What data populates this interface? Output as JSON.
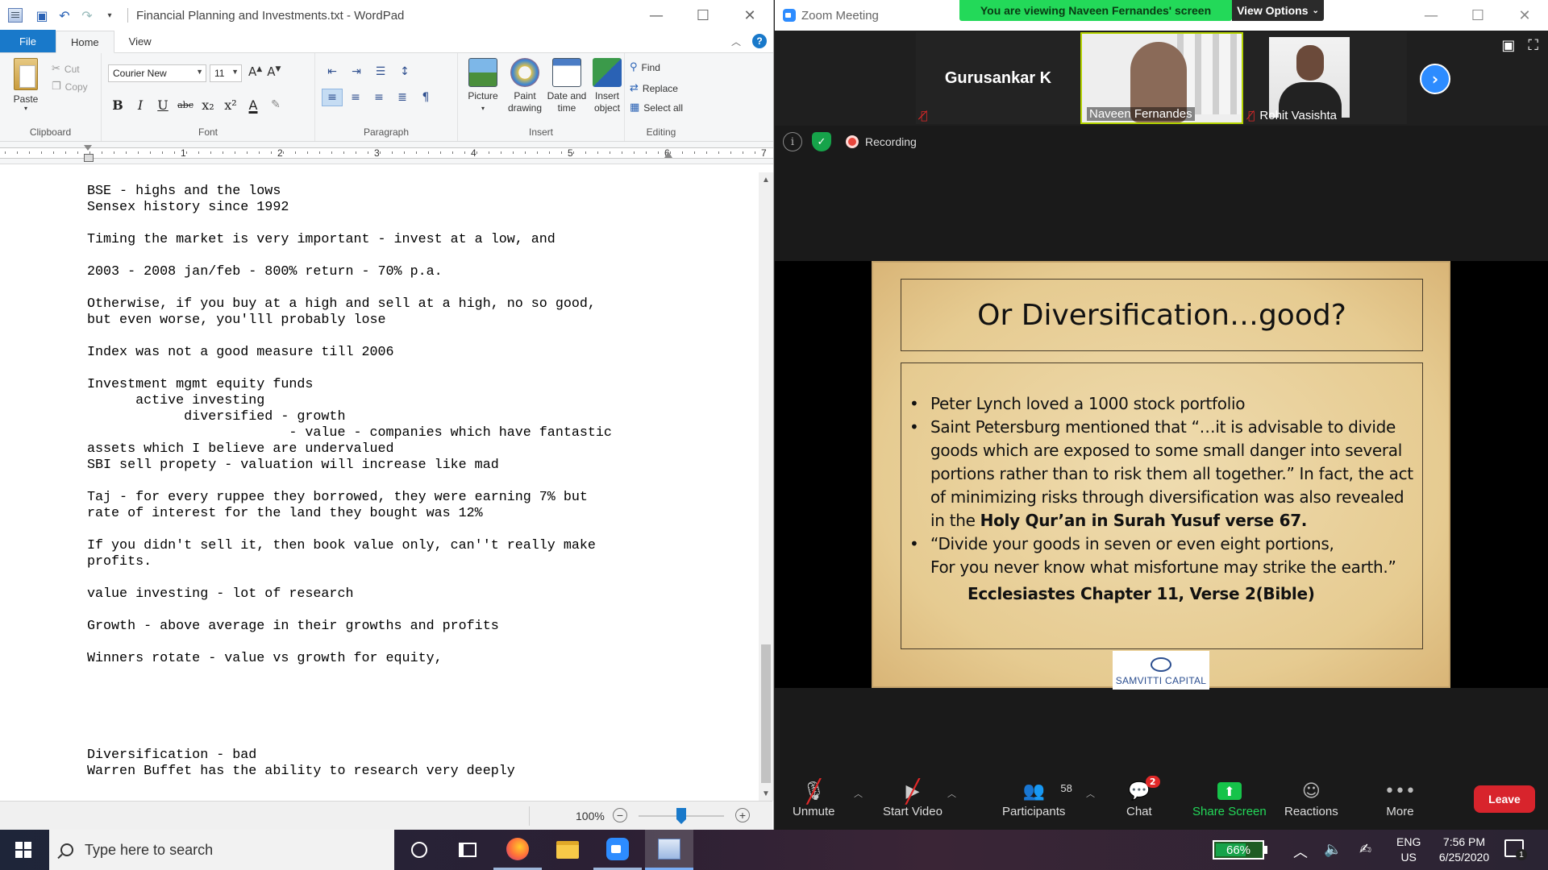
{
  "wordpad": {
    "title": "Financial Planning and Investments.txt - WordPad",
    "tabs": [
      "File",
      "Home",
      "View"
    ],
    "clipboard": {
      "paste": "Paste",
      "cut": "Cut",
      "copy": "Copy",
      "group": "Clipboard"
    },
    "font": {
      "name": "Courier New",
      "size": "11",
      "group": "Font",
      "buttons": [
        "B",
        "I",
        "U",
        "abc",
        "x₂",
        "x²",
        "A",
        "✎"
      ]
    },
    "paragraph": {
      "group": "Paragraph"
    },
    "insert": {
      "group": "Insert",
      "picture": "Picture",
      "paint_drawing": "Paint drawing",
      "date_time": "Date and time",
      "insert_object": "Insert object"
    },
    "editing": {
      "group": "Editing",
      "find": "Find",
      "replace": "Replace",
      "select_all": "Select all"
    },
    "ruler_numbers": [
      "1",
      "2",
      "3",
      "4",
      "5",
      "6",
      "7"
    ],
    "document_lines": [
      "BSE - highs and the lows",
      "Sensex history since 1992",
      "",
      "Timing the market is very important - invest at a low, and",
      "",
      "2003 - 2008 jan/feb - 800% return - 70% p.a.",
      "",
      "Otherwise, if you buy at a high and sell at a high, no so good,",
      "but even worse, you'lll probably lose",
      "",
      "Index was not a good measure till 2006",
      "",
      "Investment mgmt equity funds",
      "      active investing",
      "            diversified - growth",
      "                         - value - companies which have fantastic",
      "assets which I believe are undervalued",
      "SBI sell propety - valuation will increase like mad",
      "",
      "Taj - for every ruppee they borrowed, they were earning 7% but",
      "rate of interest for the land they bought was 12%",
      "",
      "If you didn't sell it, then book value only, can''t really make",
      "profits.",
      "",
      "value investing - lot of research",
      "",
      "Growth - above average in their growths and profits",
      "",
      "Winners rotate - value vs growth for equity,",
      "",
      "",
      "",
      "",
      "",
      "Diversification - bad",
      "Warren Buffet has the ability to research very deeply"
    ],
    "zoom_level": "100%"
  },
  "zoom": {
    "window_title": "Zoom Meeting",
    "banner": "You are viewing Naveen Fernandes' screen",
    "view_options": "View Options",
    "participants": [
      {
        "name": "Gurusankar K"
      },
      {
        "name": "Naveen Fernandes"
      },
      {
        "name": "Rohit Vasishta"
      }
    ],
    "recording": "Recording",
    "slide": {
      "title": "Or Diversification…good?",
      "bullet1": "Peter Lynch loved a 1000 stock portfolio",
      "bullet2_main": "Saint Petersburg mentioned that “…it is advisable to divide goods which are exposed to some small danger into several portions rather than to risk them all together.”  In fact, the act of minimizing risks through diversification was also revealed in the ",
      "bullet2_bold": "Holy Qur’an in Surah Yusuf verse 67.",
      "bullet3_line1": "“Divide your goods in seven or even eight portions,",
      "bullet3_line2": "For you never know what misfortune may strike the earth.”",
      "reference": "Ecclesiastes Chapter 11, Verse 2(Bible)",
      "logo_text": "SAMVITTI CAPITAL"
    },
    "toolbar": {
      "unmute": "Unmute",
      "start_video": "Start Video",
      "participants": "Participants",
      "participants_count": "58",
      "chat": "Chat",
      "chat_badge": "2",
      "share_screen": "Share Screen",
      "reactions": "Reactions",
      "more": "More",
      "leave": "Leave"
    }
  },
  "taskbar": {
    "search_placeholder": "Type here to search",
    "battery": "66%",
    "battery_fraction": 0.66,
    "lang_line1": "ENG",
    "lang_line2": "US",
    "time": "7:56 PM",
    "date": "6/25/2020",
    "notification_count": "1"
  }
}
